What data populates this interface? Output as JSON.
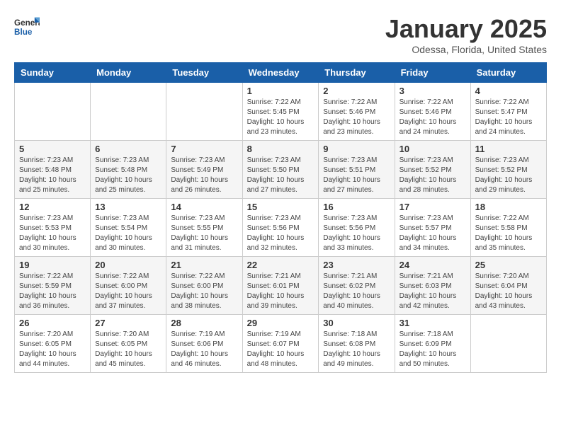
{
  "header": {
    "logo_general": "General",
    "logo_blue": "Blue",
    "title": "January 2025",
    "subtitle": "Odessa, Florida, United States"
  },
  "days_of_week": [
    "Sunday",
    "Monday",
    "Tuesday",
    "Wednesday",
    "Thursday",
    "Friday",
    "Saturday"
  ],
  "weeks": [
    [
      {
        "day": "",
        "info": ""
      },
      {
        "day": "",
        "info": ""
      },
      {
        "day": "",
        "info": ""
      },
      {
        "day": "1",
        "info": "Sunrise: 7:22 AM\nSunset: 5:45 PM\nDaylight: 10 hours\nand 23 minutes."
      },
      {
        "day": "2",
        "info": "Sunrise: 7:22 AM\nSunset: 5:46 PM\nDaylight: 10 hours\nand 23 minutes."
      },
      {
        "day": "3",
        "info": "Sunrise: 7:22 AM\nSunset: 5:46 PM\nDaylight: 10 hours\nand 24 minutes."
      },
      {
        "day": "4",
        "info": "Sunrise: 7:22 AM\nSunset: 5:47 PM\nDaylight: 10 hours\nand 24 minutes."
      }
    ],
    [
      {
        "day": "5",
        "info": "Sunrise: 7:23 AM\nSunset: 5:48 PM\nDaylight: 10 hours\nand 25 minutes."
      },
      {
        "day": "6",
        "info": "Sunrise: 7:23 AM\nSunset: 5:48 PM\nDaylight: 10 hours\nand 25 minutes."
      },
      {
        "day": "7",
        "info": "Sunrise: 7:23 AM\nSunset: 5:49 PM\nDaylight: 10 hours\nand 26 minutes."
      },
      {
        "day": "8",
        "info": "Sunrise: 7:23 AM\nSunset: 5:50 PM\nDaylight: 10 hours\nand 27 minutes."
      },
      {
        "day": "9",
        "info": "Sunrise: 7:23 AM\nSunset: 5:51 PM\nDaylight: 10 hours\nand 27 minutes."
      },
      {
        "day": "10",
        "info": "Sunrise: 7:23 AM\nSunset: 5:52 PM\nDaylight: 10 hours\nand 28 minutes."
      },
      {
        "day": "11",
        "info": "Sunrise: 7:23 AM\nSunset: 5:52 PM\nDaylight: 10 hours\nand 29 minutes."
      }
    ],
    [
      {
        "day": "12",
        "info": "Sunrise: 7:23 AM\nSunset: 5:53 PM\nDaylight: 10 hours\nand 30 minutes."
      },
      {
        "day": "13",
        "info": "Sunrise: 7:23 AM\nSunset: 5:54 PM\nDaylight: 10 hours\nand 30 minutes."
      },
      {
        "day": "14",
        "info": "Sunrise: 7:23 AM\nSunset: 5:55 PM\nDaylight: 10 hours\nand 31 minutes."
      },
      {
        "day": "15",
        "info": "Sunrise: 7:23 AM\nSunset: 5:56 PM\nDaylight: 10 hours\nand 32 minutes."
      },
      {
        "day": "16",
        "info": "Sunrise: 7:23 AM\nSunset: 5:56 PM\nDaylight: 10 hours\nand 33 minutes."
      },
      {
        "day": "17",
        "info": "Sunrise: 7:23 AM\nSunset: 5:57 PM\nDaylight: 10 hours\nand 34 minutes."
      },
      {
        "day": "18",
        "info": "Sunrise: 7:22 AM\nSunset: 5:58 PM\nDaylight: 10 hours\nand 35 minutes."
      }
    ],
    [
      {
        "day": "19",
        "info": "Sunrise: 7:22 AM\nSunset: 5:59 PM\nDaylight: 10 hours\nand 36 minutes."
      },
      {
        "day": "20",
        "info": "Sunrise: 7:22 AM\nSunset: 6:00 PM\nDaylight: 10 hours\nand 37 minutes."
      },
      {
        "day": "21",
        "info": "Sunrise: 7:22 AM\nSunset: 6:00 PM\nDaylight: 10 hours\nand 38 minutes."
      },
      {
        "day": "22",
        "info": "Sunrise: 7:21 AM\nSunset: 6:01 PM\nDaylight: 10 hours\nand 39 minutes."
      },
      {
        "day": "23",
        "info": "Sunrise: 7:21 AM\nSunset: 6:02 PM\nDaylight: 10 hours\nand 40 minutes."
      },
      {
        "day": "24",
        "info": "Sunrise: 7:21 AM\nSunset: 6:03 PM\nDaylight: 10 hours\nand 42 minutes."
      },
      {
        "day": "25",
        "info": "Sunrise: 7:20 AM\nSunset: 6:04 PM\nDaylight: 10 hours\nand 43 minutes."
      }
    ],
    [
      {
        "day": "26",
        "info": "Sunrise: 7:20 AM\nSunset: 6:05 PM\nDaylight: 10 hours\nand 44 minutes."
      },
      {
        "day": "27",
        "info": "Sunrise: 7:20 AM\nSunset: 6:05 PM\nDaylight: 10 hours\nand 45 minutes."
      },
      {
        "day": "28",
        "info": "Sunrise: 7:19 AM\nSunset: 6:06 PM\nDaylight: 10 hours\nand 46 minutes."
      },
      {
        "day": "29",
        "info": "Sunrise: 7:19 AM\nSunset: 6:07 PM\nDaylight: 10 hours\nand 48 minutes."
      },
      {
        "day": "30",
        "info": "Sunrise: 7:18 AM\nSunset: 6:08 PM\nDaylight: 10 hours\nand 49 minutes."
      },
      {
        "day": "31",
        "info": "Sunrise: 7:18 AM\nSunset: 6:09 PM\nDaylight: 10 hours\nand 50 minutes."
      },
      {
        "day": "",
        "info": ""
      }
    ]
  ]
}
